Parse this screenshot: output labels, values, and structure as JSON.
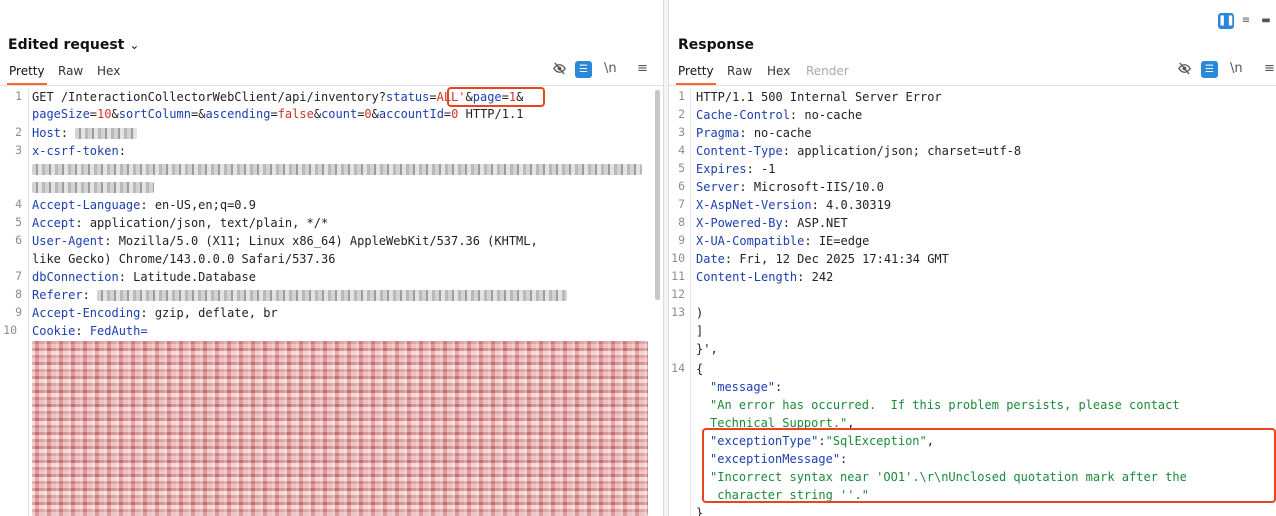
{
  "request": {
    "title": "Edited request",
    "tabs": [
      "Pretty",
      "Raw",
      "Hex"
    ],
    "line_numbers": [
      "1",
      "2",
      "3",
      "4",
      "5",
      "6",
      "7",
      "8",
      "9",
      "10"
    ],
    "line1_method": "GET /InteractionCollectorWebClient/api/inventory?",
    "line1_p1_name": "status",
    "line1_p1_val": "ALL'",
    "line1_amp1": "&",
    "line1_p2_name": "page",
    "line1_p2_val": "1",
    "line1_amp2": "&",
    "line1b_p3_name": "pageSize",
    "line1b_p3_val": "10",
    "line1b_amp3": "&",
    "line1b_p4_name": "sortColumn",
    "line1b_eq4": "=",
    "line1b_amp4": "&",
    "line1b_p5_name": "ascending",
    "line1b_p5_val": "false",
    "line1b_amp5": "&",
    "line1b_p6_name": "count",
    "line1b_p6_val": "0",
    "line1b_amp6": "&",
    "line1b_p7_name": "accountId",
    "line1b_p7_val": "0",
    "line1b_proto": " HTTP/1.1",
    "headers": [
      {
        "name": "Host",
        "value": ""
      },
      {
        "name": "x-csrf-token",
        "value": ""
      },
      {
        "name": "Accept-Language",
        "value": "en-US,en;q=0.9"
      },
      {
        "name": "Accept",
        "value": "application/json, text/plain, */*"
      },
      {
        "name": "User-Agent",
        "value": "Mozilla/5.0 (X11; Linux x86_64) AppleWebKit/537.36 (KHTML,"
      },
      {
        "name": "dbConnection",
        "value": "Latitude.Database"
      },
      {
        "name": "Referer",
        "value": ""
      },
      {
        "name": "Accept-Encoding",
        "value": "gzip, deflate, br"
      },
      {
        "name": "Cookie",
        "value": "FedAuth="
      }
    ],
    "ua_continuation": "like Gecko) Chrome/143.0.0.0 Safari/537.36"
  },
  "response": {
    "title": "Response",
    "tabs": [
      "Pretty",
      "Raw",
      "Hex",
      "Render"
    ],
    "line_numbers": [
      "1",
      "2",
      "3",
      "4",
      "5",
      "6",
      "7",
      "8",
      "9",
      "10",
      "11",
      "12",
      "13",
      "14"
    ],
    "status_line": "HTTP/1.1 500 Internal Server Error",
    "headers": [
      {
        "name": "Cache-Control",
        "value": "no-cache"
      },
      {
        "name": "Pragma",
        "value": "no-cache"
      },
      {
        "name": "Content-Type",
        "value": "application/json; charset=utf-8"
      },
      {
        "name": "Expires",
        "value": "-1"
      },
      {
        "name": "Server",
        "value": "Microsoft-IIS/10.0"
      },
      {
        "name": "X-AspNet-Version",
        "value": "4.0.30319"
      },
      {
        "name": "X-Powered-By",
        "value": "ASP.NET"
      },
      {
        "name": "X-UA-Compatible",
        "value": "IE=edge"
      },
      {
        "name": "Date",
        "value": "Fri, 12 Dec 2025 17:41:34 GMT"
      },
      {
        "name": "Content-Length",
        "value": "242"
      }
    ],
    "body_close_paren": ")",
    "body_close_bracket": "]",
    "body_close_quote": "}',",
    "body_open_brace": "{",
    "message_key": "\"message\"",
    "message_value_1": "\"An error has occurred.  If this problem persists, please contact",
    "message_value_2": "Technical Support.\"",
    "exception_type_key": "\"exceptionType\"",
    "exception_type_value": "\"SqlException\"",
    "exception_message_key": "\"exceptionMessage\"",
    "exception_message_value_1": "\"Incorrect syntax near 'OO1'.\\r\\nUnclosed quotation mark after the",
    "exception_message_value_2": " character string ''.\"",
    "body_close_brace": "}"
  },
  "punct": {
    "colon": ":",
    "colon_space": ": ",
    "equals": "=",
    "comma": ",",
    "comma_space": ", "
  },
  "toolbar": {
    "hide_icon": "eye-slash-icon",
    "format_icon": "list-icon",
    "newline_label": "\\n",
    "menu_icon": "hamburger-menu-icon"
  },
  "colors": {
    "accent_tab": "#ff6633",
    "highlight_box": "#e8451e",
    "header_name": "#1c3fae",
    "param_value": "#d2302c",
    "string": "#1b8a3a",
    "button_blue": "#2a88d8"
  }
}
